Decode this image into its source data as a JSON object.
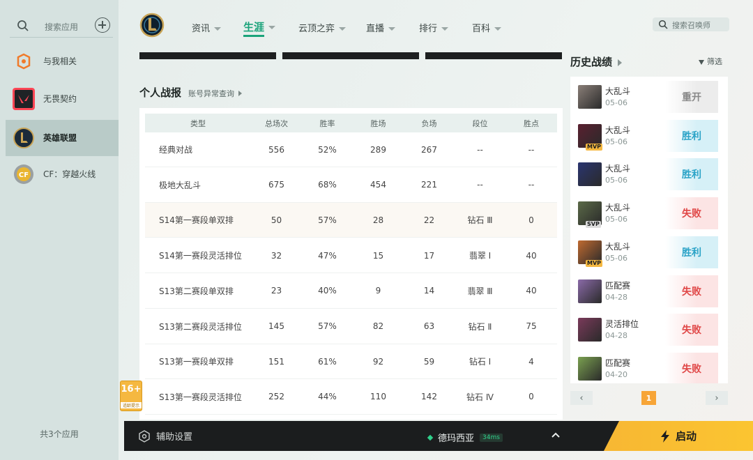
{
  "launcher": {
    "search_placeholder": "搜索应用",
    "apps": [
      {
        "label": "与我相关",
        "icon": "related-icon",
        "active": false
      },
      {
        "label": "无畏契约",
        "icon": "valorant-icon",
        "active": false
      },
      {
        "label": "英雄联盟",
        "icon": "lol-icon",
        "active": true
      },
      {
        "label": "CF：穿越火线",
        "icon": "cf-icon",
        "active": false
      }
    ],
    "count": "共3个应用"
  },
  "nav": {
    "items": [
      {
        "label": "资讯",
        "active": false
      },
      {
        "label": "生涯",
        "active": true
      },
      {
        "label": "云顶之弈",
        "active": false
      },
      {
        "label": "直播",
        "active": false
      },
      {
        "label": "排行",
        "active": false
      },
      {
        "label": "百科",
        "active": false
      }
    ],
    "search_placeholder": "搜索召唤师"
  },
  "record": {
    "title": "个人战报",
    "link": "账号异常查询",
    "headers": [
      "类型",
      "总场次",
      "胜率",
      "胜场",
      "负场",
      "段位",
      "胜点"
    ],
    "rows": [
      [
        "经典对战",
        "556",
        "52%",
        "289",
        "267",
        "--",
        "--"
      ],
      [
        "极地大乱斗",
        "675",
        "68%",
        "454",
        "221",
        "--",
        "--"
      ],
      [
        "S14第一赛段单双排",
        "50",
        "57%",
        "28",
        "22",
        "钻石 Ⅲ",
        "0"
      ],
      [
        "S14第一赛段灵活排位",
        "32",
        "47%",
        "15",
        "17",
        "翡翠 Ⅰ",
        "40"
      ],
      [
        "S13第二赛段单双排",
        "23",
        "40%",
        "9",
        "14",
        "翡翠 Ⅲ",
        "40"
      ],
      [
        "S13第二赛段灵活排位",
        "145",
        "57%",
        "82",
        "63",
        "钻石 Ⅱ",
        "75"
      ],
      [
        "S13第一赛段单双排",
        "151",
        "61%",
        "92",
        "59",
        "钻石 Ⅰ",
        "4"
      ],
      [
        "S13第一赛段灵活排位",
        "252",
        "44%",
        "110",
        "142",
        "钻石 Ⅳ",
        "0"
      ]
    ]
  },
  "history": {
    "title": "历史战绩",
    "filter": "筛选",
    "items": [
      {
        "mode": "大乱斗",
        "date": "05-06",
        "result": "重开",
        "kind": "remake",
        "badge": "",
        "color": "#8a7f78"
      },
      {
        "mode": "大乱斗",
        "date": "05-06",
        "result": "胜利",
        "kind": "win",
        "badge": "MVP",
        "color": "#5a2030"
      },
      {
        "mode": "大乱斗",
        "date": "05-06",
        "result": "胜利",
        "kind": "win",
        "badge": "",
        "color": "#2a3570"
      },
      {
        "mode": "大乱斗",
        "date": "05-06",
        "result": "失败",
        "kind": "lose",
        "badge": "SVP",
        "color": "#5b6a48"
      },
      {
        "mode": "大乱斗",
        "date": "05-06",
        "result": "胜利",
        "kind": "win",
        "badge": "MVP",
        "color": "#c06a30"
      },
      {
        "mode": "匹配赛",
        "date": "04-28",
        "result": "失败",
        "kind": "lose",
        "badge": "",
        "color": "#8a6aa8"
      },
      {
        "mode": "灵活排位",
        "date": "04-28",
        "result": "失败",
        "kind": "lose",
        "badge": "",
        "color": "#7a3a5a"
      },
      {
        "mode": "匹配赛",
        "date": "04-20",
        "result": "失败",
        "kind": "lose",
        "badge": "",
        "color": "#7aa050"
      }
    ],
    "page": "1",
    "prev": "‹",
    "next": "›"
  },
  "age_badge": {
    "number": "16+",
    "sub": "适龄提示"
  },
  "bottom": {
    "helper": "辅助设置",
    "server": "德玛西亚",
    "ping": "34ms",
    "launch": "启动"
  }
}
